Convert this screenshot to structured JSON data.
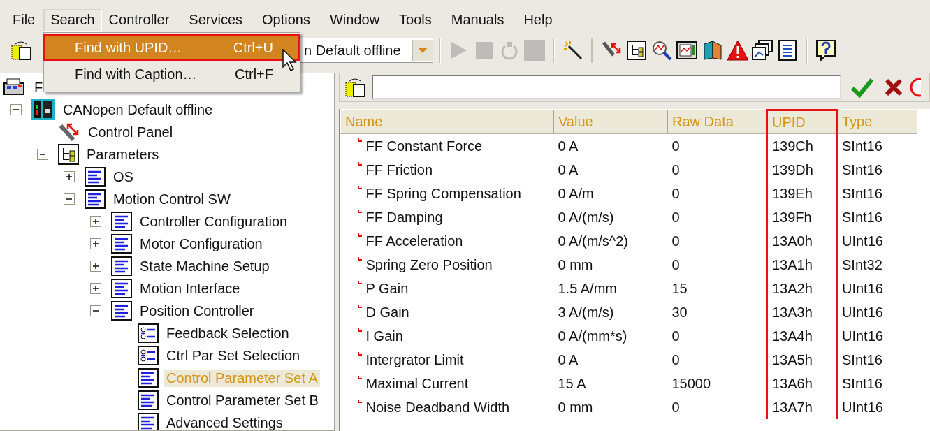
{
  "menu_bar": [
    {
      "label": "File",
      "selected": false
    },
    {
      "label": "Search",
      "selected": true
    },
    {
      "label": "Controller",
      "selected": false
    },
    {
      "label": "Services",
      "selected": false
    },
    {
      "label": "Options",
      "selected": false
    },
    {
      "label": "Window",
      "selected": false
    },
    {
      "label": "Tools",
      "selected": false
    },
    {
      "label": "Manuals",
      "selected": false
    },
    {
      "label": "Help",
      "selected": false
    }
  ],
  "search_menu": [
    {
      "label": "Find with UPID…",
      "shortcut": "Ctrl+U",
      "selected": true,
      "highlighted": true
    },
    {
      "label": "Find with Caption…",
      "shortcut": "Ctrl+F",
      "selected": false,
      "highlighted": false
    }
  ],
  "toolbar": {
    "configuration": "n Default offline",
    "buttons": [
      {
        "kind": "play",
        "disabled": true
      },
      {
        "kind": "stop",
        "disabled": true
      },
      {
        "kind": "reset",
        "disabled": true
      },
      {
        "kind": "square",
        "disabled": true
      },
      {
        "kind": "separator"
      },
      {
        "kind": "wand",
        "disabled": false
      },
      {
        "kind": "separator"
      },
      {
        "kind": "plug",
        "disabled": false
      },
      {
        "kind": "tree",
        "disabled": false
      },
      {
        "kind": "search",
        "disabled": false
      },
      {
        "kind": "monitor",
        "disabled": false
      },
      {
        "kind": "book",
        "disabled": false
      },
      {
        "kind": "warning",
        "disabled": false
      },
      {
        "kind": "windows",
        "disabled": false
      },
      {
        "kind": "list",
        "disabled": false
      },
      {
        "kind": "separator"
      },
      {
        "kind": "help",
        "disabled": false
      }
    ]
  },
  "tree": {
    "root": {
      "label": "F",
      "children": [
        {
          "label": "CANopen Default offline",
          "kind": "device",
          "expanded": true,
          "selected": false,
          "children": [
            {
              "label": "Control Panel",
              "kind": "control",
              "selected": false
            },
            {
              "label": "Parameters",
              "kind": "parameters",
              "expanded": true,
              "selected": false,
              "children": [
                {
                  "label": "OS",
                  "kind": "list",
                  "expanded": false,
                  "selected": false
                },
                {
                  "label": "Motion Control SW",
                  "kind": "list",
                  "expanded": true,
                  "selected": false,
                  "children": [
                    {
                      "label": "Controller Configuration",
                      "kind": "list",
                      "expanded": false,
                      "selected": false
                    },
                    {
                      "label": "Motor Configuration",
                      "kind": "list",
                      "expanded": false,
                      "selected": false
                    },
                    {
                      "label": "State Machine Setup",
                      "kind": "list",
                      "expanded": false,
                      "selected": false
                    },
                    {
                      "label": "Motion Interface",
                      "kind": "list",
                      "expanded": false,
                      "selected": false
                    },
                    {
                      "label": "Position Controller",
                      "kind": "list",
                      "expanded": true,
                      "selected": false,
                      "children": [
                        {
                          "label": "Feedback Selection",
                          "kind": "selection",
                          "selected": false
                        },
                        {
                          "label": "Ctrl Par Set Selection",
                          "kind": "selection",
                          "selected": false
                        },
                        {
                          "label": "Control Parameter Set A",
                          "kind": "list",
                          "selected": true
                        },
                        {
                          "label": "Control Parameter Set B",
                          "kind": "list",
                          "selected": false
                        },
                        {
                          "label": "Advanced Settings",
                          "kind": "list",
                          "selected": false
                        }
                      ]
                    }
                  ]
                }
              ]
            }
          ]
        }
      ]
    }
  },
  "table": {
    "columns": [
      {
        "label": "Name",
        "highlighted": false
      },
      {
        "label": "Value",
        "highlighted": false
      },
      {
        "label": "Raw Data",
        "highlighted": false
      },
      {
        "label": "UPID",
        "highlighted": true
      },
      {
        "label": "Type",
        "highlighted": false
      }
    ],
    "rows": [
      [
        "FF Constant Force",
        "0 A",
        "0",
        "139Ch",
        "SInt16"
      ],
      [
        "FF Friction",
        "0 A",
        "0",
        "139Dh",
        "SInt16"
      ],
      [
        "FF Spring Compensation",
        "0 A/m",
        "0",
        "139Eh",
        "SInt16"
      ],
      [
        "FF Damping",
        "0 A/(m/s)",
        "0",
        "139Fh",
        "SInt16"
      ],
      [
        "FF Acceleration",
        "0 A/(m/s^2)",
        "0",
        "13A0h",
        "UInt16"
      ],
      [
        "Spring Zero Position",
        "0 mm",
        "0",
        "13A1h",
        "SInt32"
      ],
      [
        "P Gain",
        "1.5 A/mm",
        "15",
        "13A2h",
        "UInt16"
      ],
      [
        "D Gain",
        "3 A/(m/s)",
        "30",
        "13A3h",
        "UInt16"
      ],
      [
        "I Gain",
        "0 A/(mm*s)",
        "0",
        "13A4h",
        "UInt16"
      ],
      [
        "Intergrator Limit",
        "0 A",
        "0",
        "13A5h",
        "SInt16"
      ],
      [
        "Maximal Current",
        "15 A",
        "15000",
        "13A6h",
        "SInt16"
      ],
      [
        "Noise Deadband Width",
        "0 mm",
        "0",
        "13A7h",
        "UInt16"
      ]
    ]
  }
}
